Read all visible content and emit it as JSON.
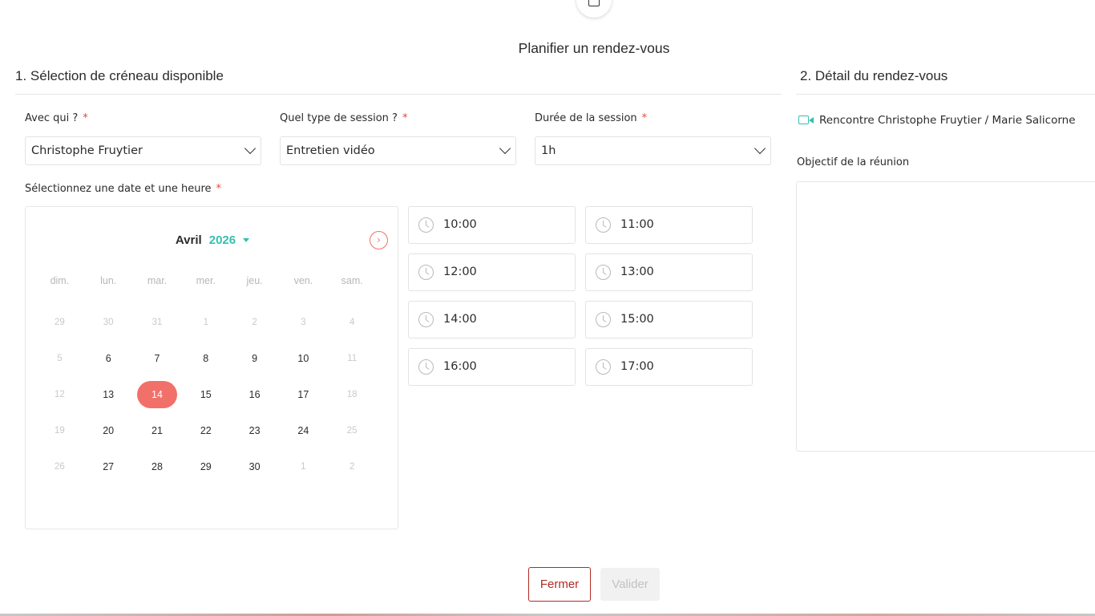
{
  "modal": {
    "title": "Planifier un rendez-vous"
  },
  "section1": {
    "title": "1. Sélection de créneau disponible",
    "with_who": {
      "label": "Avec qui ?",
      "required_mark": "*",
      "value": "Christophe Fruytier"
    },
    "session_type": {
      "label": "Quel type de session ?",
      "required_mark": "*",
      "value": "Entretien vidéo"
    },
    "duration": {
      "label": "Durée de la session",
      "required_mark": "*",
      "value": "1h"
    },
    "date_label": "Sélectionnez une date et une heure",
    "date_required_mark": "*",
    "calendar": {
      "month": "Avril",
      "year": "2026",
      "next_icon": "chevron-right-icon",
      "weekdays": [
        "dim.",
        "lun.",
        "mar.",
        "mer.",
        "jeu.",
        "ven.",
        "sam."
      ],
      "weeks": [
        [
          {
            "d": "29",
            "s": "muted"
          },
          {
            "d": "30",
            "s": "muted"
          },
          {
            "d": "31",
            "s": "muted"
          },
          {
            "d": "1",
            "s": "muted"
          },
          {
            "d": "2",
            "s": "muted"
          },
          {
            "d": "3",
            "s": "muted"
          },
          {
            "d": "4",
            "s": "muted"
          }
        ],
        [
          {
            "d": "5",
            "s": "muted"
          },
          {
            "d": "6",
            "s": "active"
          },
          {
            "d": "7",
            "s": "active"
          },
          {
            "d": "8",
            "s": "active"
          },
          {
            "d": "9",
            "s": "active"
          },
          {
            "d": "10",
            "s": "active"
          },
          {
            "d": "11",
            "s": "muted"
          }
        ],
        [
          {
            "d": "12",
            "s": "muted"
          },
          {
            "d": "13",
            "s": "active"
          },
          {
            "d": "14",
            "s": "selected"
          },
          {
            "d": "15",
            "s": "active"
          },
          {
            "d": "16",
            "s": "active"
          },
          {
            "d": "17",
            "s": "active"
          },
          {
            "d": "18",
            "s": "muted"
          }
        ],
        [
          {
            "d": "19",
            "s": "muted"
          },
          {
            "d": "20",
            "s": "active"
          },
          {
            "d": "21",
            "s": "active"
          },
          {
            "d": "22",
            "s": "active"
          },
          {
            "d": "23",
            "s": "active"
          },
          {
            "d": "24",
            "s": "active"
          },
          {
            "d": "25",
            "s": "muted"
          }
        ],
        [
          {
            "d": "26",
            "s": "muted"
          },
          {
            "d": "27",
            "s": "active"
          },
          {
            "d": "28",
            "s": "active"
          },
          {
            "d": "29",
            "s": "active"
          },
          {
            "d": "30",
            "s": "active"
          },
          {
            "d": "1",
            "s": "muted"
          },
          {
            "d": "2",
            "s": "muted"
          }
        ]
      ],
      "selected_day": "14",
      "colors": {
        "accent": "#f2706a",
        "year": "#35c0b0"
      }
    },
    "time_slots": [
      "10:00",
      "11:00",
      "12:00",
      "13:00",
      "14:00",
      "15:00",
      "16:00",
      "17:00"
    ]
  },
  "section2": {
    "title": "2. Détail du rendez-vous",
    "meeting_icon": "video-camera-icon",
    "meeting_title": "Rencontre Christophe Fruytier / Marie Salicorne",
    "objective_label": "Objectif de la réunion",
    "objective_value": ""
  },
  "buttons": {
    "close": "Fermer",
    "validate": "Valider"
  },
  "colors": {
    "accent": "#f2706a",
    "teal": "#35c0b0",
    "danger": "#b22a22"
  }
}
